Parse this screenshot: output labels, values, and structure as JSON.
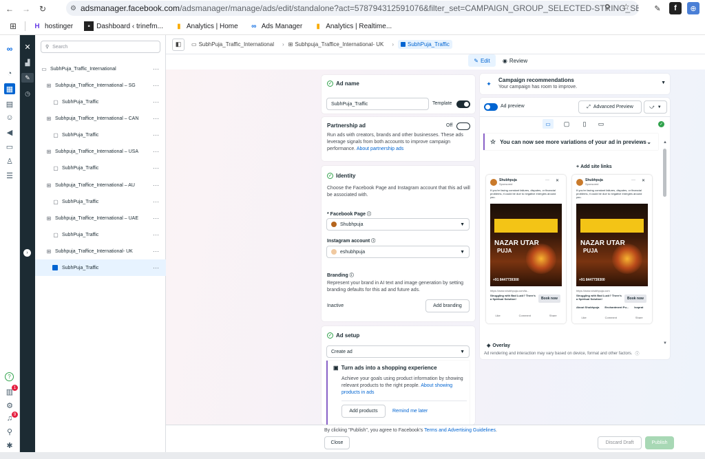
{
  "browser": {
    "url_host": "adsmanager.facebook.com",
    "url_path": "/adsmanager/manage/ads/edit/standalone?act=578794312591076&filter_set=CAMPAIGN_GROUP_SELECTED-STRING_SET%..."
  },
  "bookmarks": [
    {
      "label": "hostinger",
      "icon": "hostinger-logo"
    },
    {
      "label": "Dashboard ‹ trinefm...",
      "icon": "dashboard-logo"
    },
    {
      "label": "Analytics | Home",
      "icon": "analytics-logo"
    },
    {
      "label": "Ads Manager",
      "icon": "meta-logo"
    },
    {
      "label": "Analytics | Realtime...",
      "icon": "analytics-logo"
    }
  ],
  "tree": {
    "search_placeholder": "Search",
    "campaign": "SubhPuja_Traffic_International",
    "rows": [
      {
        "label": "Subhpuja_Traffice_International – SG",
        "type": "adset"
      },
      {
        "label": "SubhPuja_Traffic",
        "type": "ad"
      },
      {
        "label": "Subhpuja_Traffice_International – CAN",
        "type": "adset"
      },
      {
        "label": "SubhPuja_Traffic",
        "type": "ad"
      },
      {
        "label": "Subhpuja_Traffice_International – USA",
        "type": "adset"
      },
      {
        "label": "SubhPuja_Traffic",
        "type": "ad"
      },
      {
        "label": "Subhpuja_Traffice_International – AU",
        "type": "adset"
      },
      {
        "label": "SubhPuja_Traffic",
        "type": "ad"
      },
      {
        "label": "Subhpuja_Traffice_International – UAE",
        "type": "adset"
      },
      {
        "label": "SubhPuja_Traffic",
        "type": "ad"
      },
      {
        "label": "Subhpuja_Traffice_International- UK",
        "type": "adset"
      },
      {
        "label": "SubhPuja_Traffic",
        "type": "ad",
        "selected": true
      }
    ]
  },
  "rail_badges": {
    "notifications": "1",
    "alerts": "9"
  },
  "breadcrumb": {
    "campaign": "SubhPuja_Traffic_International",
    "adset": "Subhpuja_Traffice_International- UK",
    "ad": "SubhPuja_Traffic"
  },
  "tabs": {
    "edit": "Edit",
    "review": "Review"
  },
  "ad_name": {
    "title": "Ad name",
    "value": "SubhPuja_Traffic",
    "template_label": "Template"
  },
  "partnership": {
    "title": "Partnership ad",
    "state": "Off",
    "description": "Run ads with creators, brands and other businesses. These ads leverage signals from both accounts to improve campaign performance.",
    "link": "About partnership ads"
  },
  "identity": {
    "title": "Identity",
    "description": "Choose the Facebook Page and Instagram account that this ad will be associated with.",
    "fb_label": "* Facebook Page",
    "fb_value": "Shubhpuja",
    "ig_label": "Instagram account",
    "ig_value": "eshubhpuja",
    "branding_title": "Branding",
    "branding_desc": "Represent your brand in AI text and image generation by setting branding defaults for this ad and future ads.",
    "branding_status": "Inactive",
    "branding_button": "Add branding"
  },
  "ad_setup": {
    "title": "Ad setup",
    "select_value": "Create ad",
    "shop_title": "Turn ads into a shopping experience",
    "shop_desc": "Achieve your goals using product information by showing relevant products to the right people.",
    "shop_link": "About showing products in ads",
    "add_products": "Add products",
    "remind": "Remind me later"
  },
  "recommendations": {
    "title": "Campaign recommendations",
    "subtitle": "Your campaign has room to improve."
  },
  "preview": {
    "toggle_label": "Ad preview",
    "advanced": "Advanced Preview",
    "banner": "You can now see more variations of your ad in previews",
    "add_site_links": "Add site links",
    "overlay": "Overlay",
    "disclaimer": "Ad rendering and interaction may vary based on device, format and other factors."
  },
  "ads": [
    {
      "page": "Shubhpuja",
      "sponsored": "Sponsored",
      "text": "If you're facing constant failures, disputes, or financial problems, it could be due to negative energies around you.",
      "headline1": "NAZAR UTAR",
      "headline2": "PUJA",
      "phone": "+91 8447739300",
      "url": "https://www.shubhpuja.com/ta...",
      "cta_text": "Struggling with Bad Luck? There's a Spiritual Solution!",
      "cta": "Book now",
      "like": "Like",
      "comment": "Comment",
      "share": "Share"
    },
    {
      "page": "Shubhpuja",
      "sponsored": "Sponsored",
      "text": "If you're facing constant failures, disputes, or financial problems, it could be due to negative energies around you.",
      "headline1": "NAZAR UTAR",
      "headline2": "PUJA",
      "phone": "+91 8447739300",
      "url": "https://www.shubhpuja.com",
      "cta_text": "Struggling with Bad Luck? There's a Spiritual Solution!",
      "cta": "Book now",
      "extra1": "About Shubhpuja",
      "extra2": "Enchantment Pu...",
      "extra3": "Issprat",
      "like": "Like",
      "comment": "Comment",
      "share": "Share"
    }
  ],
  "footer": {
    "notice_prefix": "By clicking \"Publish\", you agree to Facebook's ",
    "notice_link": "Terms and Advertising Guidelines",
    "notice_suffix": ".",
    "close": "Close",
    "discard": "Discard Draft",
    "publish": "Publish"
  }
}
